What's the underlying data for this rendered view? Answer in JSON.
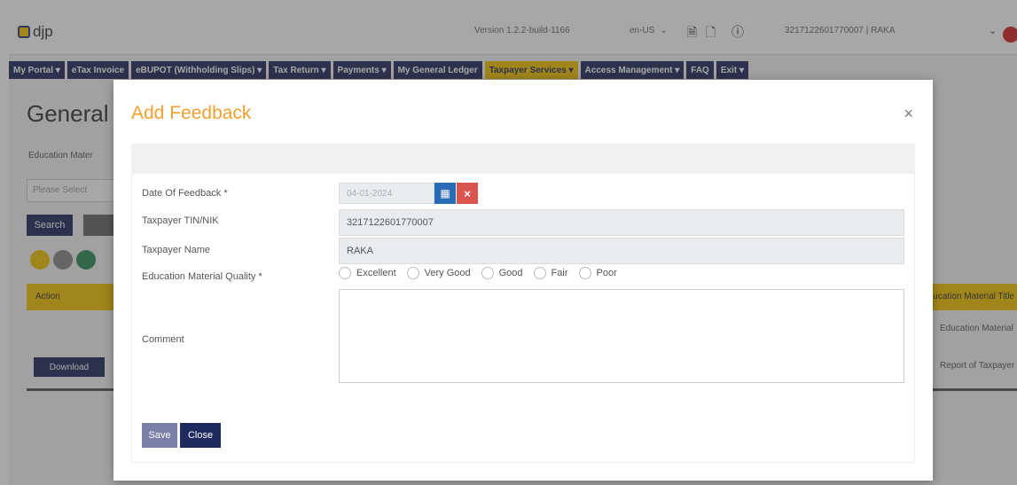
{
  "app": {
    "logo_text": "djp",
    "version_text": "Version 1.2.2-build-1166",
    "language": "en-US",
    "user_text": "3217122601770007 | RAKA",
    "menu": [
      {
        "label": "My Portal ▾"
      },
      {
        "label": "eTax Invoice"
      },
      {
        "label": "eBUPOT (Withholding Slips) ▾"
      },
      {
        "label": "Tax Return ▾"
      },
      {
        "label": "Payments ▾"
      },
      {
        "label": "My General Ledger"
      },
      {
        "label": "Taxpayer Services ▾",
        "active": true
      },
      {
        "label": "Access Management ▾"
      },
      {
        "label": "FAQ"
      },
      {
        "label": "Exit ▾"
      }
    ]
  },
  "background": {
    "page_title": "General",
    "filter_label": "Education Mater",
    "select_placeholder": "Please Select",
    "search_label": "Search",
    "table_head": "Action",
    "table_head_right": "Education Material Title",
    "row_text_1": "Education Material",
    "row_text_2": "Report of Taxpayer",
    "download_label": "Download"
  },
  "modal": {
    "title": "Add Feedback",
    "close_symbol": "×",
    "fields": {
      "date_label": "Date Of Feedback *",
      "date_value": "04-01-2024",
      "tin_label": "Taxpayer TIN/NIK",
      "tin_value": "3217122601770007",
      "name_label": "Taxpayer Name",
      "name_value": "RAKA",
      "quality_label": "Education Material Quality *",
      "quality_options": [
        "Excellent",
        "Very Good",
        "Good",
        "Fair",
        "Poor"
      ],
      "comment_label": "Comment",
      "comment_value": ""
    },
    "buttons": {
      "save": "Save",
      "close": "Close"
    }
  },
  "colors": {
    "navy": "#1f2a5e",
    "accent_yellow": "#f2c200",
    "title_orange": "#f0a030",
    "calendar_blue": "#2a6bb5",
    "clear_red": "#d9534f"
  },
  "icons": {
    "calendar": "calendar-icon",
    "clear": "clear-icon",
    "close": "close-icon"
  }
}
